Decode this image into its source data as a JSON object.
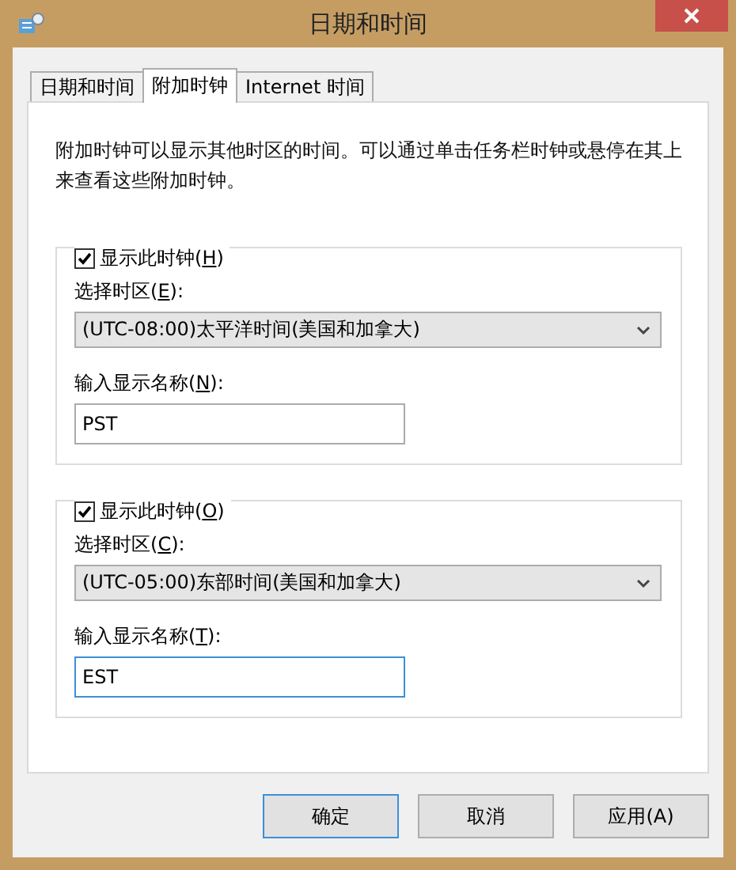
{
  "window": {
    "title": "日期和时间"
  },
  "tabs": [
    {
      "label": "日期和时间",
      "selected": false
    },
    {
      "label": "附加时钟",
      "selected": true
    },
    {
      "label": "Internet 时间",
      "selected": false
    }
  ],
  "description": "附加时钟可以显示其他时区的时间。可以通过单击任务栏时钟或悬停在其上来查看这些附加时钟。",
  "clocks": [
    {
      "show": {
        "pre": "显示此时钟(",
        "key": "H",
        "post": ")",
        "checked": true
      },
      "zone_label": {
        "pre": "选择时区(",
        "key": "E",
        "post": "):"
      },
      "zone": "(UTC-08:00)太平洋时间(美国和加拿大)",
      "name_label": {
        "pre": "输入显示名称(",
        "key": "N",
        "post": "):"
      },
      "name": "PST",
      "focused": false
    },
    {
      "show": {
        "pre": "显示此时钟(",
        "key": "O",
        "post": ")",
        "checked": true
      },
      "zone_label": {
        "pre": "选择时区(",
        "key": "C",
        "post": "):"
      },
      "zone": "(UTC-05:00)东部时间(美国和加拿大)",
      "name_label": {
        "pre": "输入显示名称(",
        "key": "T",
        "post": "):"
      },
      "name": "EST",
      "focused": true
    }
  ],
  "buttons": [
    {
      "label": "确定",
      "default": true
    },
    {
      "label": "取消",
      "default": false
    },
    {
      "label": "应用(A)",
      "default": false
    }
  ]
}
